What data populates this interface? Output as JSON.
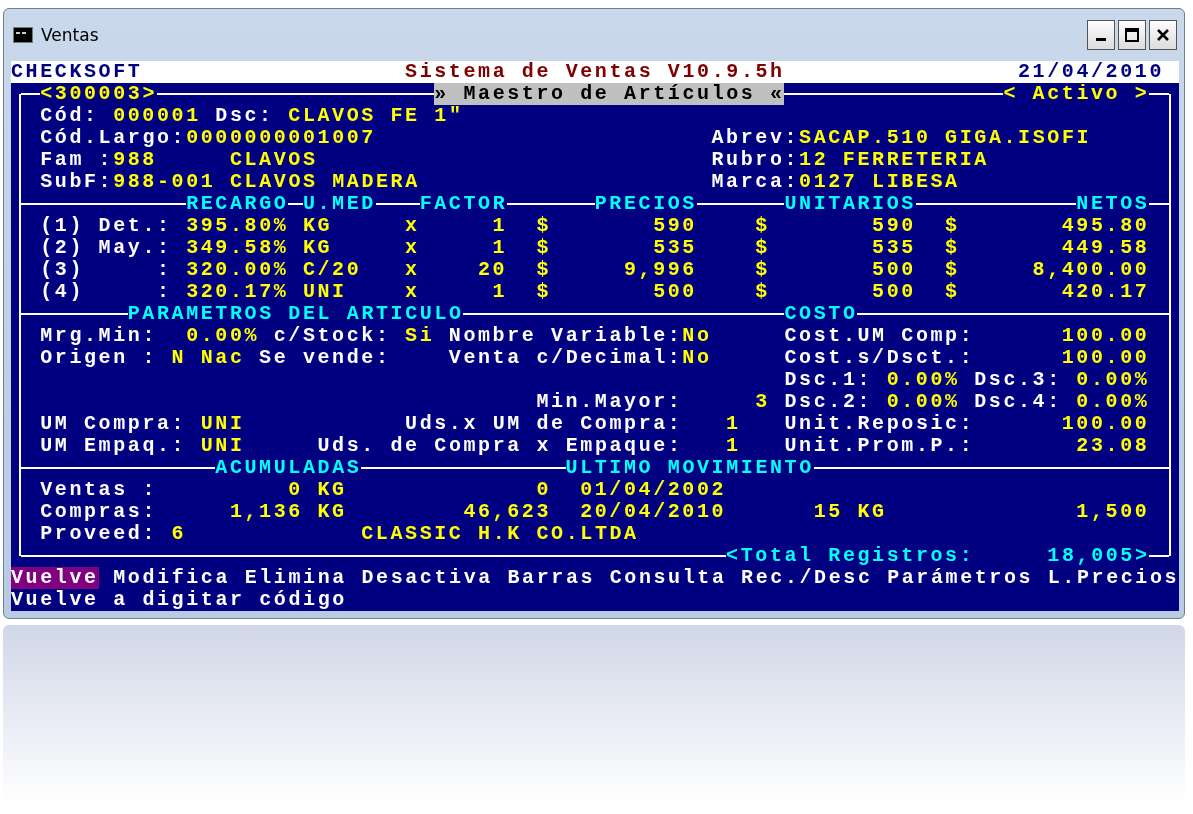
{
  "window": {
    "title": "Ventas"
  },
  "header": {
    "company": "CHECKSOFT",
    "system": "Sistema de Ventas V10.9.5h",
    "date": "21/04/2010"
  },
  "record": {
    "code": "<300003>",
    "screen": "» Maestro de Artículos «",
    "status": "< Activo >"
  },
  "article": [
    {
      "label": "Cód:",
      "value": "000001"
    },
    {
      "label": "Dsc:",
      "value": "CLAVOS FE 1\""
    },
    {
      "label": "Cód.Largo:",
      "value": "0000000001007"
    },
    {
      "label": "Abrev:",
      "value": "SACAP.510 GIGA.ISOFI"
    },
    {
      "label": "Fam :",
      "value": "988"
    },
    {
      "value": "CLAVOS"
    },
    {
      "label": "Rubro:",
      "value": "12 FERRETERIA"
    },
    {
      "label": "SubF:",
      "value": "988-001 CLAVOS MADERA"
    },
    {
      "label": "Marca:",
      "value": "0127 LIBESA"
    }
  ],
  "prices": {
    "columns": [
      "RECARGO",
      "U.MED",
      "FACTOR",
      "PRECIOS",
      "UNITARIOS",
      "NETOS"
    ],
    "rows": [
      {
        "label": "(1) Det.:",
        "recargo": "395.80%",
        "umed": "KG",
        "times": "x",
        "factor": "1",
        "currency_1": "$",
        "precio": "590",
        "currency_2": "$",
        "unitario": "590",
        "currency_3": "$",
        "neto": "495.80"
      },
      {
        "label": "(2) May.:",
        "recargo": "349.58%",
        "umed": "KG",
        "times": "x",
        "factor": "1",
        "currency_1": "$",
        "precio": "535",
        "currency_2": "$",
        "unitario": "535",
        "currency_3": "$",
        "neto": "449.58"
      },
      {
        "label": "(3)     :",
        "recargo": "320.00%",
        "umed": "C/20",
        "times": "x",
        "factor": "20",
        "currency_1": "$",
        "precio": "9,996",
        "currency_2": "$",
        "unitario": "500",
        "currency_3": "$",
        "neto": "8,400.00"
      },
      {
        "label": "(4)     :",
        "recargo": "320.17%",
        "umed": "UNI",
        "times": "x",
        "factor": "1",
        "currency_1": "$",
        "precio": "500",
        "currency_2": "$",
        "unitario": "500",
        "currency_3": "$",
        "neto": "420.17"
      }
    ]
  },
  "parameters": {
    "title": "PARAMETROS DEL ARTICULO",
    "fields": [
      {
        "label": "Mrg.Min:",
        "value": "0.00%"
      },
      {
        "label": "c/Stock:",
        "value": "Si"
      },
      {
        "label": "Nombre Variable:",
        "value": "No"
      },
      {
        "label": "Origen :",
        "value": "N Nac"
      },
      {
        "label": "Se vende:"
      },
      {
        "label": "Venta c/Decimal:",
        "value": "No"
      },
      {
        "label": "Min.Mayor:",
        "value": "3"
      },
      {
        "label": "UM Compra:",
        "value": "UNI"
      },
      {
        "label": "Uds.x UM de Compra:",
        "value": "1"
      },
      {
        "label": "UM Empaq.:",
        "value": "UNI"
      },
      {
        "label": "Uds. de Compra x Empaque:",
        "value": "1"
      }
    ]
  },
  "cost": {
    "title": "COSTO",
    "fields": [
      {
        "label": "Cost.UM Comp:",
        "value": "100.00"
      },
      {
        "label": "Cost.s/Dsct.:",
        "value": "100.00"
      },
      {
        "label": "Dsc.1:",
        "value": "0.00%"
      },
      {
        "label": "Dsc.3:",
        "value": "0.00%"
      },
      {
        "label": "Dsc.2:",
        "value": "0.00%"
      },
      {
        "label": "Dsc.4:",
        "value": "0.00%"
      },
      {
        "label": "Unit.Reposic:",
        "value": "100.00"
      },
      {
        "label": "Unit.Prom.P.:",
        "value": "23.08"
      }
    ]
  },
  "totals": {
    "titles": [
      "ACUMULADAS",
      "ULTIMO MOVIMIENTO"
    ],
    "rows": [
      {
        "label": "Ventas :",
        "quantity": "0 KG",
        "amount": "0",
        "date": "01/04/2002"
      },
      {
        "label": "Compras:",
        "quantity": "1,136 KG",
        "amount": "46,623",
        "date": "20/04/2010",
        "last_quantity": "15 KG",
        "last_amount": "1,500"
      },
      {
        "label": "Proveed:",
        "code": "6",
        "name": "CLASSIC H.K CO.LTDA"
      }
    ]
  },
  "total_records": "<Total Registros:     18,005>",
  "menu": {
    "items": [
      {
        "label": "Vuelve",
        "selected": true
      },
      {
        "label": "Modifica",
        "selected": false
      },
      {
        "label": "Elimina",
        "selected": false
      },
      {
        "label": "Desactiva",
        "selected": false
      },
      {
        "label": "Barras",
        "selected": false
      },
      {
        "label": "Consulta",
        "selected": false
      },
      {
        "label": "Rec./Desc",
        "selected": false
      },
      {
        "label": "Parámetros",
        "selected": false
      },
      {
        "label": "L.Precios",
        "selected": false
      }
    ]
  },
  "hint": "Vuelve a digitar código"
}
